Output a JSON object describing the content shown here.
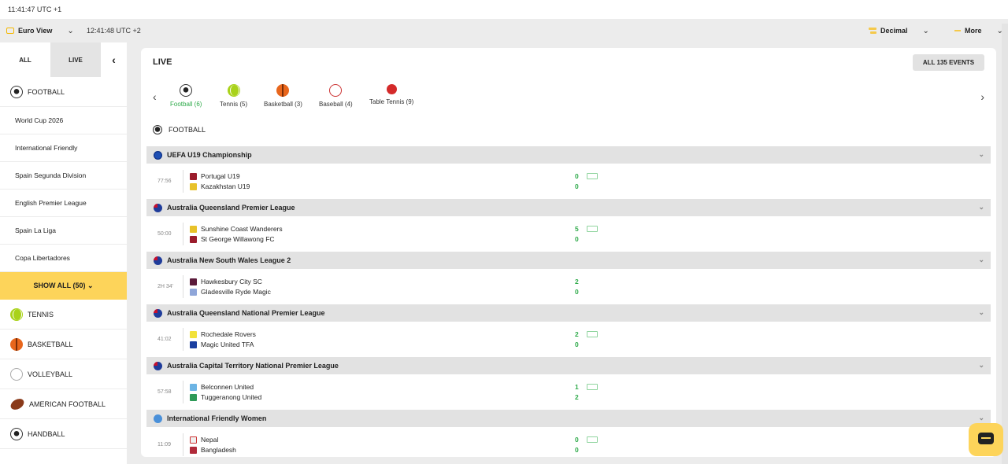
{
  "system": {
    "clock": "11:41:47 UTC +1"
  },
  "topbar": {
    "view_label": "Euro View",
    "clock": "12:41:48 UTC +2",
    "odds_format": "Decimal",
    "more_label": "More",
    "chevron": "⌄"
  },
  "sidebar": {
    "tab_all": "ALL",
    "tab_live": "LIVE",
    "collapse": "‹",
    "football": "FOOTBALL",
    "leagues": [
      "World Cup 2026",
      "International Friendly",
      "Spain Segunda Division",
      "English Premier League",
      "Spain La Liga",
      "Copa Libertadores"
    ],
    "show_all": "SHOW ALL (50) ⌄",
    "sports": [
      "TENNIS",
      "BASKETBALL",
      "VOLLEYBALL",
      "AMERICAN FOOTBALL",
      "HANDBALL"
    ]
  },
  "main": {
    "title": "LIVE",
    "all_events": "ALL 135 EVENTS",
    "carousel": {
      "prev": "‹",
      "next": "›",
      "tabs": [
        "Football (6)",
        "Tennis (5)",
        "Basketball (3)",
        "Baseball (4)",
        "Table Tennis (9)"
      ]
    },
    "section": "FOOTBALL",
    "league_chevron": "⌄",
    "leagues": [
      {
        "name": "UEFA U19 Championship",
        "time": "77:56",
        "team1": "Portugal U19",
        "team2": "Kazakhstan U19",
        "score1": "0",
        "score2": "0"
      },
      {
        "name": "Australia Queensland Premier League",
        "time": "50:00",
        "team1": "Sunshine Coast Wanderers",
        "team2": "St George Willawong FC",
        "score1": "5",
        "score2": "0"
      },
      {
        "name": "Australia New South Wales League 2",
        "time": "2H 34'",
        "team1": "Hawkesbury City SC",
        "team2": "Gladesville Ryde Magic",
        "score1": "2",
        "score2": "0"
      },
      {
        "name": "Australia Queensland National Premier League",
        "time": "41:02",
        "team1": "Rochedale Rovers",
        "team2": "Magic United TFA",
        "score1": "2",
        "score2": "0"
      },
      {
        "name": "Australia Capital Territory National Premier League",
        "time": "57:58",
        "team1": "Belconnen United",
        "team2": "Tuggeranong United",
        "score1": "1",
        "score2": "2"
      },
      {
        "name": "International Friendly Women",
        "time": "11:09",
        "team1": "Nepal",
        "team2": "Bangladesh",
        "score1": "0",
        "score2": "0"
      }
    ]
  },
  "colors": {
    "accent": "#fdd45a",
    "score_green": "#2eaa4a"
  }
}
